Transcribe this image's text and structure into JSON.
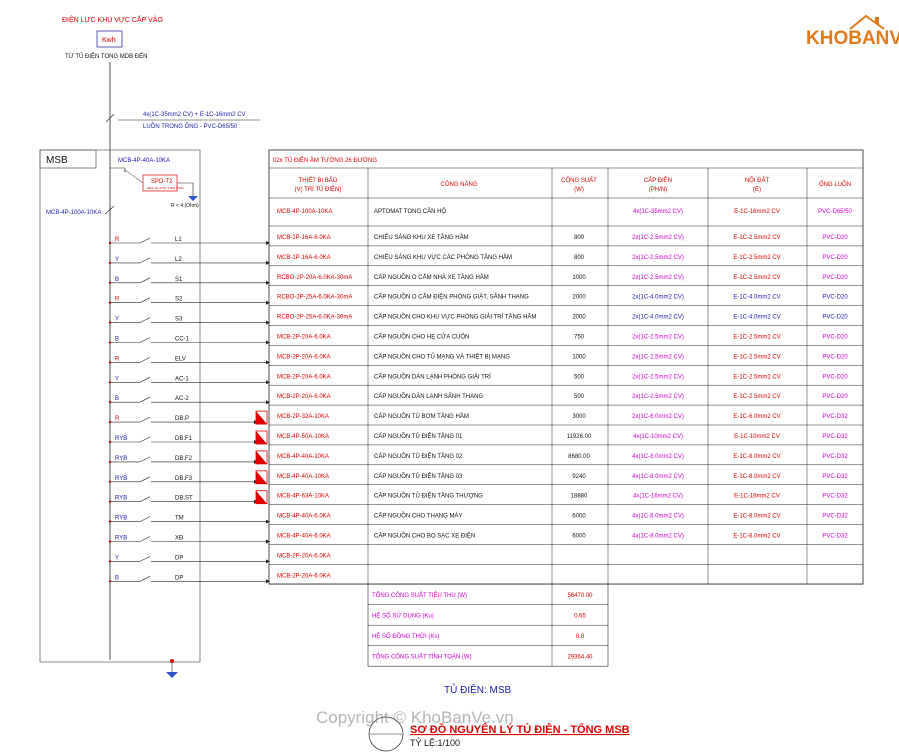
{
  "top": {
    "source_label": "ĐIỆN LỰC KHU VỰC CẤP VÀO",
    "meter_label": "Kwh",
    "from_label": "TỪ TỦ ĐIỆN TONG MDB ĐẾN",
    "feeder_cable": "4x(1C-35mm2 CV)  +  E-1C-16mm2 CV",
    "feeder_conduit": "LUỒN TRONG ỐNG - PVC-D65/50"
  },
  "panel": {
    "name": "MSB",
    "spd_breaker": "MCB-4P-40A-10KA",
    "spd_label": "SPD-T2",
    "spd_sub": "20kA·4P·275V·1.5kV·0.5KV",
    "earth_label": "R < 4 (Ohm)",
    "main_breaker": "MCB-4P-100A-10KA"
  },
  "circuits": [
    {
      "phase": "R",
      "name": "L1"
    },
    {
      "phase": "Y",
      "name": "L2"
    },
    {
      "phase": "B",
      "name": "S1"
    },
    {
      "phase": "R",
      "name": "S2"
    },
    {
      "phase": "Y",
      "name": "S3"
    },
    {
      "phase": "B",
      "name": "CC-1"
    },
    {
      "phase": "R",
      "name": "ELV"
    },
    {
      "phase": "Y",
      "name": "AC-1"
    },
    {
      "phase": "B",
      "name": "AC-2"
    },
    {
      "phase": "R",
      "name": "DB.P"
    },
    {
      "phase": "RYB",
      "name": "DB.F1"
    },
    {
      "phase": "RYB",
      "name": "DB.F2"
    },
    {
      "phase": "RYB",
      "name": "DB.F3"
    },
    {
      "phase": "RYB",
      "name": "DB.ST"
    },
    {
      "phase": "RYB",
      "name": "TM"
    },
    {
      "phase": "RYB",
      "name": "XĐ"
    },
    {
      "phase": "Y",
      "name": "DP"
    },
    {
      "phase": "B",
      "name": "DP"
    }
  ],
  "table": {
    "caption": "02x TỦ ĐIỆN ÂM TƯỜNG 26 ĐƯỜNG",
    "headers": {
      "device": [
        "THIẾT BỊ BẢO",
        "(V) TRÍ TỦ ĐIỆN)"
      ],
      "function": "CÔNG NĂNG",
      "power": [
        "CÔNG SUẤT",
        "(W)"
      ],
      "cable": [
        "CÁP ĐIỆN",
        "(PH/N)"
      ],
      "earth": [
        "NỐI ĐẤT",
        "(E)"
      ],
      "conduit": "ỐNG LUỒN"
    },
    "main_row": {
      "device": "MCB-4P-100A-10KA",
      "function": "APTOMAT TONG CĂN HỘ",
      "power": "",
      "cable": "4x(1C-35mm2 CV)",
      "earth": "E-1C-16mm2 CV",
      "conduit": "PVC-D65/50"
    },
    "rows": [
      {
        "device": "MCB-1P-16A-6.0KA",
        "function": "CHIẾU SÁNG KHU XE TẦNG HẦM",
        "power": "800",
        "cable": "2x(1C-2.5mm2 CV)",
        "earth": "E-1C-2.5mm2 CV",
        "conduit": "PVC-D20"
      },
      {
        "device": "MCB-1P-16A-6.0KA",
        "function": "CHIẾU SÁNG KHU VỰC CÁC PHÒNG TẦNG HẦM",
        "power": "800",
        "cable": "2x(1C-2.5mm2 CV)",
        "earth": "E-1C-2.5mm2 CV",
        "conduit": "PVC-D20"
      },
      {
        "device": "RCBO-2P-20A-6.0KA-30mA",
        "function": "CẤP NGUỒN O CẮM NHÀ XE TẦNG HẦM",
        "power": "1000",
        "cable": "2x(1C-2.5mm2 CV)",
        "earth": "E-1C-2.5mm2 CV",
        "conduit": "PVC-D20"
      },
      {
        "device": "RCBO-2P-25A-6.0KA-30mA",
        "function": "CẤP NGUỒN O CẮM ĐIỆN PHÒNG GIẶT, SẢNH THANG",
        "power": "2000",
        "cable": "2x(1C-4.0mm2 CV)",
        "earth": "E-1C-4.0mm2 CV",
        "conduit": "PVC-D20"
      },
      {
        "device": "RCBO-2P-25A-6.0KA-30mA",
        "function": "CẤP NGUỒN CHO KHU VỰC PHÒNG GIẢI TRÍ TẦNG HẦM",
        "power": "2000",
        "cable": "2x(1C-4.0mm2 CV)",
        "earth": "E-1C-4.0mm2 CV",
        "conduit": "PVC-D20"
      },
      {
        "device": "MCB-2P-20A-6.0KA",
        "function": "CẤP NGUỒN CHO HẸ CỬA CUỐN",
        "power": "750",
        "cable": "2x(1C-2.5mm2 CV)",
        "earth": "E-1C-2.5mm2 CV",
        "conduit": "PVC-D20"
      },
      {
        "device": "MCB-2P-20A-6.0KA",
        "function": "CẤP NGUỒN CHO TỦ MẠNG VÀ THIẾT BỊ MẠNG",
        "power": "1000",
        "cable": "2x(1C-2.5mm2 CV)",
        "earth": "E-1C-2.5mm2 CV",
        "conduit": "PVC-D20"
      },
      {
        "device": "MCB-2P-20A-6.0KA",
        "function": "CẤP NGUỒN DÀN LẠNH PHÒNG GIẢI TRÍ",
        "power": "500",
        "cable": "2x(1C-2.5mm2 CV)",
        "earth": "E-1C-2.5mm2 CV",
        "conduit": "PVC-D20"
      },
      {
        "device": "MCB-2P-20A-6.0KA",
        "function": "CẤP NGUỒN DÀN LẠNH SẢNH THANG",
        "power": "500",
        "cable": "2x(1C-2.5mm2 CV)",
        "earth": "E-1C-2.5mm2 CV",
        "conduit": "PVC-D20"
      },
      {
        "device": "MCB-2P-32A-10KA",
        "function": "CẤP NGUỒN TỦ BƠM TẦNG HẦM",
        "power": "3000",
        "cable": "2x(1C-6.0mm2 CV)",
        "earth": "E-1C-6.0mm2 CV",
        "conduit": "PVC-D32"
      },
      {
        "device": "MCB-4P-50A-10KA",
        "function": "CẤP NGUỒN TỦ ĐIỆN TẦNG 01",
        "power": "11926.00",
        "cable": "4x(1C-10mm2 CV)",
        "earth": "E-1C-10mm2 CV",
        "conduit": "PVC-D32"
      },
      {
        "device": "MCB-4P-40A-10KA",
        "function": "CẤP NGUỒN TỦ ĐIỆN TẦNG 02",
        "power": "8680.00",
        "cable": "4x(1C-8.0mm2 CV)",
        "earth": "E-1C-8.0mm2 CV",
        "conduit": "PVC-D32"
      },
      {
        "device": "MCB-4P-40A-10KA",
        "function": "CẤP NGUỒN TỦ ĐIỆN TẦNG 03",
        "power": "9240",
        "cable": "4x(1C-8.0mm2 CV)",
        "earth": "E-1C-8.0mm2 CV",
        "conduit": "PVC-D32"
      },
      {
        "device": "MCB-4P-63A-10KA",
        "function": "CẤP NGUỒN TỦ ĐIỆN TẦNG THƯỢNG",
        "power": "18880",
        "cable": "4x(1C-16mm2 CV)",
        "earth": "E-1C-16mm2 CV",
        "conduit": "PVC-D32"
      },
      {
        "device": "MCB-4P-40A-6.0KA",
        "function": "CẤP NGUỒN CHO THANG MÁY",
        "power": "6000",
        "cable": "4x(1C-8.0mm2 CV)",
        "earth": "E-1C-8.0mm2 CV",
        "conduit": "PVC-D32"
      },
      {
        "device": "MCB-4P-40A-6.0KA",
        "function": "CẤP NGUỒN CHO BỌ SẠC XE ĐIỆN",
        "power": "6000",
        "cable": "4x(1C-8.0mm2 CV)",
        "earth": "E-1C-8.0mm2 CV",
        "conduit": "PVC-D32"
      },
      {
        "device": "MCB-2P-20A-6.0KA",
        "function": "",
        "power": "",
        "cable": "",
        "earth": "",
        "conduit": ""
      },
      {
        "device": "MCB-2P-20A-6.0KA",
        "function": "",
        "power": "",
        "cable": "",
        "earth": "",
        "conduit": ""
      }
    ],
    "summary": [
      {
        "label": "TỔNG CÔNG SUẤT TIÊU THỤ (W)",
        "value": "56470.00"
      },
      {
        "label": "HỆ SỐ SỬ DỤNG (Ku)",
        "value": "0.65"
      },
      {
        "label": "HỆ SỐ ĐỒNG THỜI (Ks)",
        "value": "0.8"
      },
      {
        "label": "TỔNG CÔNG SUẤT TÍNH TOÁN (W)",
        "value": "29364.40"
      }
    ]
  },
  "footer": {
    "panel_label": "TỦ ĐIỆN: MSB",
    "title": "SƠ ĐỒ NGUYÊN LÝ TỦ ĐIỆN - TỔNG MSB",
    "scale": "TỶ LỆ:1/100"
  },
  "brand": {
    "logo": "KHOBANVE",
    "watermark": "Copyright © KhoBanVe.vn"
  },
  "colors": {
    "red": "#e00000",
    "blue": "#1a1ab0",
    "magenta": "#d000d0",
    "logo": "#e07a1a"
  }
}
